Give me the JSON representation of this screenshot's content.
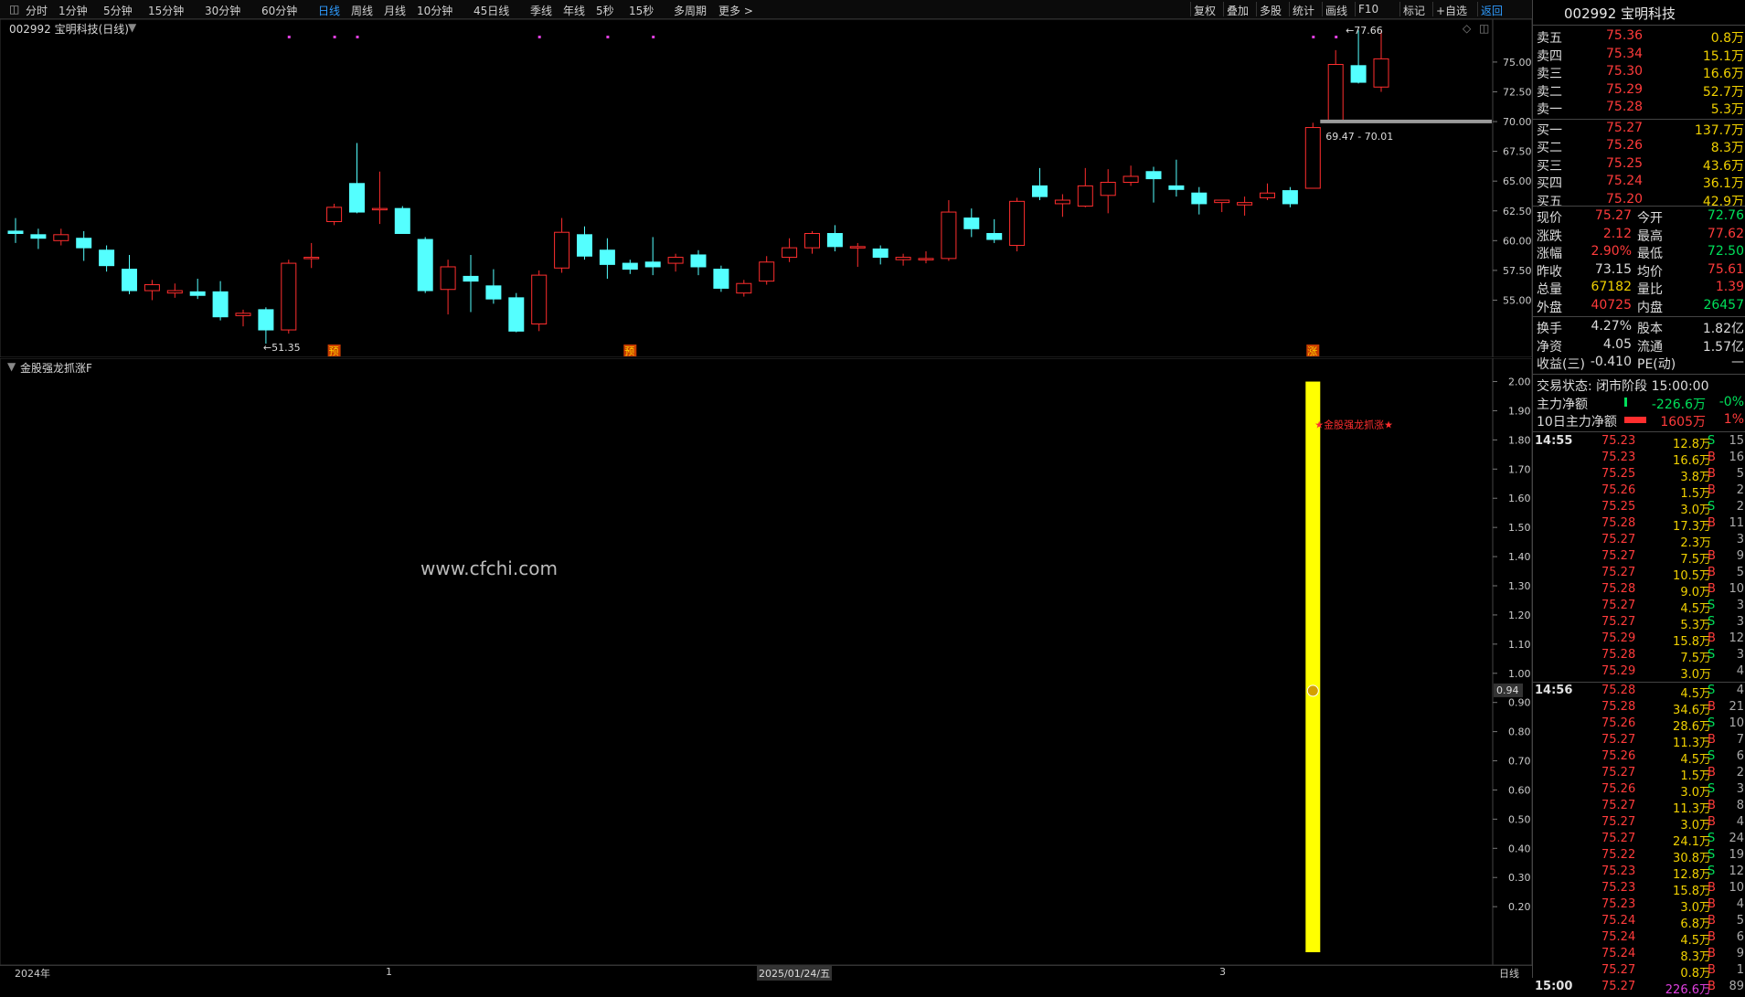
{
  "toolbar": {
    "left_tabs": [
      "分时",
      "1分钟",
      "5分钟",
      "15分钟",
      "30分钟",
      "60分钟",
      "日线",
      "周线",
      "月线",
      "10分钟",
      "45日线",
      "季线",
      "年线",
      "5秒",
      "15秒",
      "多周期",
      "更多 >"
    ],
    "active_tab": "日线",
    "right_tabs": [
      "复权",
      "叠加",
      "多股",
      "统计",
      "画线",
      "F10",
      "标记",
      "+自选",
      "返回"
    ]
  },
  "main_chart": {
    "title": "002992 宝明科技(日线)",
    "high_label": "77.66",
    "low_label": "51.35",
    "gap_label": "69.47 - 70.01",
    "markers": [
      "预",
      "预",
      "涨"
    ]
  },
  "indicator": {
    "title": "金股强龙抓涨F",
    "signal_label": "★金股强龙抓涨★",
    "current_value_label": "0.94",
    "watermark": "www.cfchi.com"
  },
  "bottom_axis": {
    "labels": [
      "2024年",
      "1",
      "2025/01/24/五",
      "3"
    ],
    "period": "日线",
    "time_label": "15:00"
  },
  "chart_data": {
    "type": "candlestick",
    "price_axis": {
      "ticks": [
        "75.00",
        "72.50",
        "70.00",
        "67.50",
        "65.00",
        "62.50",
        "60.00",
        "57.50",
        "55.00"
      ],
      "range": [
        50.2,
        78.6
      ]
    },
    "indicator_axis": {
      "ticks": [
        "2.00",
        "1.90",
        "1.80",
        "1.70",
        "1.60",
        "1.50",
        "1.40",
        "1.30",
        "1.20",
        "1.10",
        "1.00",
        "0.90",
        "0.80",
        "0.70",
        "0.60",
        "0.50",
        "0.40",
        "0.30",
        "0.20"
      ],
      "range": [
        0,
        2.08
      ]
    },
    "candles": [
      {
        "o": 60.8,
        "c": 60.6,
        "h": 61.9,
        "l": 59.8
      },
      {
        "o": 60.5,
        "c": 60.2,
        "h": 61.0,
        "l": 59.3
      },
      {
        "o": 60.0,
        "c": 60.5,
        "h": 61.0,
        "l": 59.6
      },
      {
        "o": 60.2,
        "c": 59.4,
        "h": 60.8,
        "l": 58.3
      },
      {
        "o": 59.2,
        "c": 57.9,
        "h": 59.6,
        "l": 57.4
      },
      {
        "o": 57.6,
        "c": 55.8,
        "h": 58.8,
        "l": 55.5
      },
      {
        "o": 55.8,
        "c": 56.3,
        "h": 56.7,
        "l": 55.0
      },
      {
        "o": 55.6,
        "c": 55.8,
        "h": 56.4,
        "l": 55.2
      },
      {
        "o": 55.7,
        "c": 55.4,
        "h": 56.8,
        "l": 55.1
      },
      {
        "o": 55.7,
        "c": 53.6,
        "h": 56.6,
        "l": 53.3
      },
      {
        "o": 53.7,
        "c": 53.9,
        "h": 54.2,
        "l": 52.8
      },
      {
        "o": 54.2,
        "c": 52.5,
        "h": 54.4,
        "l": 51.35
      },
      {
        "o": 52.5,
        "c": 58.1,
        "h": 58.4,
        "l": 52.2
      },
      {
        "o": 58.5,
        "c": 58.6,
        "h": 59.8,
        "l": 57.7
      },
      {
        "o": 61.6,
        "c": 62.8,
        "h": 63.1,
        "l": 61.3
      },
      {
        "o": 64.8,
        "c": 62.4,
        "h": 68.2,
        "l": 62.3
      },
      {
        "o": 62.6,
        "c": 62.7,
        "h": 65.8,
        "l": 61.4
      },
      {
        "o": 62.7,
        "c": 60.6,
        "h": 62.9,
        "l": 60.6
      },
      {
        "o": 60.1,
        "c": 55.8,
        "h": 60.3,
        "l": 55.6
      },
      {
        "o": 55.9,
        "c": 57.8,
        "h": 58.4,
        "l": 53.8
      },
      {
        "o": 57.0,
        "c": 56.6,
        "h": 58.8,
        "l": 54.0
      },
      {
        "o": 56.2,
        "c": 55.1,
        "h": 57.6,
        "l": 54.7
      },
      {
        "o": 55.2,
        "c": 52.4,
        "h": 55.6,
        "l": 52.3
      },
      {
        "o": 53.0,
        "c": 57.1,
        "h": 57.5,
        "l": 52.4
      },
      {
        "o": 57.7,
        "c": 60.7,
        "h": 61.9,
        "l": 57.3
      },
      {
        "o": 60.5,
        "c": 58.7,
        "h": 61.2,
        "l": 58.4
      },
      {
        "o": 59.2,
        "c": 58.0,
        "h": 60.2,
        "l": 56.8
      },
      {
        "o": 58.1,
        "c": 57.6,
        "h": 58.4,
        "l": 57.2
      },
      {
        "o": 58.2,
        "c": 57.8,
        "h": 60.3,
        "l": 57.1
      },
      {
        "o": 58.1,
        "c": 58.6,
        "h": 58.9,
        "l": 57.4
      },
      {
        "o": 58.8,
        "c": 57.8,
        "h": 59.2,
        "l": 57.1
      },
      {
        "o": 57.6,
        "c": 56.0,
        "h": 57.9,
        "l": 55.7
      },
      {
        "o": 55.6,
        "c": 56.4,
        "h": 56.7,
        "l": 55.3
      },
      {
        "o": 56.6,
        "c": 58.2,
        "h": 58.7,
        "l": 56.3
      },
      {
        "o": 58.6,
        "c": 59.4,
        "h": 60.2,
        "l": 58.2
      },
      {
        "o": 59.4,
        "c": 60.6,
        "h": 60.8,
        "l": 58.9
      },
      {
        "o": 60.6,
        "c": 59.5,
        "h": 61.3,
        "l": 59.1
      },
      {
        "o": 59.4,
        "c": 59.5,
        "h": 59.8,
        "l": 57.8
      },
      {
        "o": 59.3,
        "c": 58.6,
        "h": 59.6,
        "l": 58.0
      },
      {
        "o": 58.4,
        "c": 58.6,
        "h": 58.9,
        "l": 57.9
      },
      {
        "o": 58.4,
        "c": 58.5,
        "h": 59.1,
        "l": 58.1
      },
      {
        "o": 58.5,
        "c": 62.4,
        "h": 63.4,
        "l": 58.3
      },
      {
        "o": 61.9,
        "c": 61.0,
        "h": 62.7,
        "l": 60.3
      },
      {
        "o": 60.6,
        "c": 60.1,
        "h": 61.8,
        "l": 59.8
      },
      {
        "o": 59.6,
        "c": 63.3,
        "h": 63.6,
        "l": 59.1
      },
      {
        "o": 64.6,
        "c": 63.7,
        "h": 66.1,
        "l": 63.4
      },
      {
        "o": 63.1,
        "c": 63.4,
        "h": 63.9,
        "l": 62.0
      },
      {
        "o": 62.9,
        "c": 64.6,
        "h": 66.1,
        "l": 62.8
      },
      {
        "o": 63.8,
        "c": 64.9,
        "h": 66.0,
        "l": 62.3
      },
      {
        "o": 64.9,
        "c": 65.4,
        "h": 66.3,
        "l": 64.6
      },
      {
        "o": 65.8,
        "c": 65.2,
        "h": 66.2,
        "l": 63.2
      },
      {
        "o": 64.6,
        "c": 64.3,
        "h": 66.8,
        "l": 63.7
      },
      {
        "o": 64.0,
        "c": 63.1,
        "h": 64.5,
        "l": 62.2
      },
      {
        "o": 63.2,
        "c": 63.4,
        "h": 63.4,
        "l": 62.4
      },
      {
        "o": 63.0,
        "c": 63.2,
        "h": 63.7,
        "l": 62.1
      },
      {
        "o": 63.6,
        "c": 64.0,
        "h": 64.8,
        "l": 63.4
      },
      {
        "o": 64.2,
        "c": 63.1,
        "h": 64.5,
        "l": 62.8
      },
      {
        "o": 64.4,
        "c": 69.5,
        "h": 69.9,
        "l": 64.4
      },
      {
        "o": 70.0,
        "c": 74.8,
        "h": 76.0,
        "l": 69.9
      },
      {
        "o": 74.7,
        "c": 73.3,
        "h": 77.66,
        "l": 73.2
      },
      {
        "o": 72.9,
        "c": 75.27,
        "h": 77.62,
        "l": 72.5
      }
    ],
    "indicator_bar": {
      "candle_index": 57,
      "value": 2.0
    },
    "current_indicator_value": 0.94
  },
  "quote": {
    "code_name": "002992 宝明科技",
    "sell": [
      {
        "label": "卖五",
        "price": "75.36",
        "vol": "0.8万"
      },
      {
        "label": "卖四",
        "price": "75.34",
        "vol": "15.1万"
      },
      {
        "label": "卖三",
        "price": "75.30",
        "vol": "16.6万"
      },
      {
        "label": "卖二",
        "price": "75.29",
        "vol": "52.7万"
      },
      {
        "label": "卖一",
        "price": "75.28",
        "vol": "5.3万"
      }
    ],
    "buy": [
      {
        "label": "买一",
        "price": "75.27",
        "vol": "137.7万"
      },
      {
        "label": "买二",
        "price": "75.26",
        "vol": "8.3万"
      },
      {
        "label": "买三",
        "price": "75.25",
        "vol": "43.6万"
      },
      {
        "label": "买四",
        "price": "75.24",
        "vol": "36.1万"
      },
      {
        "label": "买五",
        "price": "75.20",
        "vol": "42.9万"
      }
    ],
    "stats": [
      {
        "l1": "现价",
        "v1": "75.27",
        "c1": "#ff3b3b",
        "l2": "今开",
        "v2": "72.76",
        "c2": "#00e05a"
      },
      {
        "l1": "涨跌",
        "v1": "2.12",
        "c1": "#ff3b3b",
        "l2": "最高",
        "v2": "77.62",
        "c2": "#ff3b3b"
      },
      {
        "l1": "涨幅",
        "v1": "2.90%",
        "c1": "#ff3b3b",
        "l2": "最低",
        "v2": "72.50",
        "c2": "#00e05a"
      },
      {
        "l1": "昨收",
        "v1": "73.15",
        "c1": "#dcdcdc",
        "l2": "均价",
        "v2": "75.61",
        "c2": "#ff3b3b"
      },
      {
        "l1": "总量",
        "v1": "67182",
        "c1": "#f0d000",
        "l2": "量比",
        "v2": "1.39",
        "c2": "#ff3b3b"
      },
      {
        "l1": "外盘",
        "v1": "40725",
        "c1": "#ff3b3b",
        "l2": "内盘",
        "v2": "26457",
        "c2": "#00e05a"
      }
    ],
    "stats2": [
      {
        "l1": "换手",
        "v1": "4.27%",
        "l2": "股本",
        "v2": "1.82亿"
      },
      {
        "l1": "净资",
        "v1": "4.05",
        "l2": "流通",
        "v2": "1.57亿"
      },
      {
        "l1": "收益(三)",
        "v1": "-0.410",
        "l2": "PE(动)",
        "v2": "—"
      }
    ],
    "trade_status": "交易状态: 闭市阶段 15:00:00",
    "main_net": {
      "label": "主力净额",
      "value": "-226.6万",
      "pct": "-0%"
    },
    "main_net10": {
      "label": "10日主力净额",
      "value": "1605万",
      "pct": "1%"
    }
  },
  "ticks": [
    {
      "t": "14:55",
      "p": "75.23",
      "v": "12.8万",
      "bs": "S",
      "n": "15"
    },
    {
      "t": "",
      "p": "75.23",
      "v": "16.6万",
      "bs": "B",
      "n": "16"
    },
    {
      "t": "",
      "p": "75.25",
      "v": "3.8万",
      "bs": "B",
      "n": "5"
    },
    {
      "t": "",
      "p": "75.26",
      "v": "1.5万",
      "bs": "B",
      "n": "2"
    },
    {
      "t": "",
      "p": "75.25",
      "v": "3.0万",
      "bs": "S",
      "n": "2"
    },
    {
      "t": "",
      "p": "75.28",
      "v": "17.3万",
      "bs": "B",
      "n": "11"
    },
    {
      "t": "",
      "p": "75.27",
      "v": "2.3万",
      "bs": "",
      "n": "3"
    },
    {
      "t": "",
      "p": "75.27",
      "v": "7.5万",
      "bs": "B",
      "n": "9"
    },
    {
      "t": "",
      "p": "75.27",
      "v": "10.5万",
      "bs": "B",
      "n": "5"
    },
    {
      "t": "",
      "p": "75.28",
      "v": "9.0万",
      "bs": "B",
      "n": "10"
    },
    {
      "t": "",
      "p": "75.27",
      "v": "4.5万",
      "bs": "S",
      "n": "3"
    },
    {
      "t": "",
      "p": "75.27",
      "v": "5.3万",
      "bs": "S",
      "n": "3"
    },
    {
      "t": "",
      "p": "75.29",
      "v": "15.8万",
      "bs": "B",
      "n": "12"
    },
    {
      "t": "",
      "p": "75.28",
      "v": "7.5万",
      "bs": "S",
      "n": "3"
    },
    {
      "t": "",
      "p": "75.29",
      "v": "3.0万",
      "bs": "",
      "n": "4"
    },
    {
      "t": "14:56",
      "p": "75.28",
      "v": "4.5万",
      "bs": "S",
      "n": "4"
    },
    {
      "t": "",
      "p": "75.28",
      "v": "34.6万",
      "bs": "B",
      "n": "21"
    },
    {
      "t": "",
      "p": "75.26",
      "v": "28.6万",
      "bs": "S",
      "n": "10"
    },
    {
      "t": "",
      "p": "75.27",
      "v": "11.3万",
      "bs": "B",
      "n": "7"
    },
    {
      "t": "",
      "p": "75.26",
      "v": "4.5万",
      "bs": "S",
      "n": "6"
    },
    {
      "t": "",
      "p": "75.27",
      "v": "1.5万",
      "bs": "B",
      "n": "2"
    },
    {
      "t": "",
      "p": "75.26",
      "v": "3.0万",
      "bs": "S",
      "n": "3"
    },
    {
      "t": "",
      "p": "75.27",
      "v": "11.3万",
      "bs": "B",
      "n": "8"
    },
    {
      "t": "",
      "p": "75.27",
      "v": "3.0万",
      "bs": "B",
      "n": "4"
    },
    {
      "t": "",
      "p": "75.27",
      "v": "24.1万",
      "bs": "S",
      "n": "24"
    },
    {
      "t": "",
      "p": "75.22",
      "v": "30.8万",
      "bs": "S",
      "n": "19"
    },
    {
      "t": "",
      "p": "75.23",
      "v": "12.8万",
      "bs": "S",
      "n": "12"
    },
    {
      "t": "",
      "p": "75.23",
      "v": "15.8万",
      "bs": "B",
      "n": "10"
    },
    {
      "t": "",
      "p": "75.23",
      "v": "3.0万",
      "bs": "B",
      "n": "4"
    },
    {
      "t": "",
      "p": "75.24",
      "v": "6.8万",
      "bs": "B",
      "n": "5"
    },
    {
      "t": "",
      "p": "75.24",
      "v": "4.5万",
      "bs": "B",
      "n": "6"
    },
    {
      "t": "",
      "p": "75.24",
      "v": "8.3万",
      "bs": "B",
      "n": "9"
    },
    {
      "t": "",
      "p": "75.27",
      "v": "0.8万",
      "bs": "B",
      "n": "1"
    },
    {
      "t": "15:00",
      "p": "75.27",
      "v": "226.6万",
      "bs": "B",
      "n": "89"
    }
  ],
  "colors": {
    "up": "#ff2e2e",
    "down": "#54ffff",
    "signal": "#ffff00",
    "accent": "#2f9cff"
  }
}
